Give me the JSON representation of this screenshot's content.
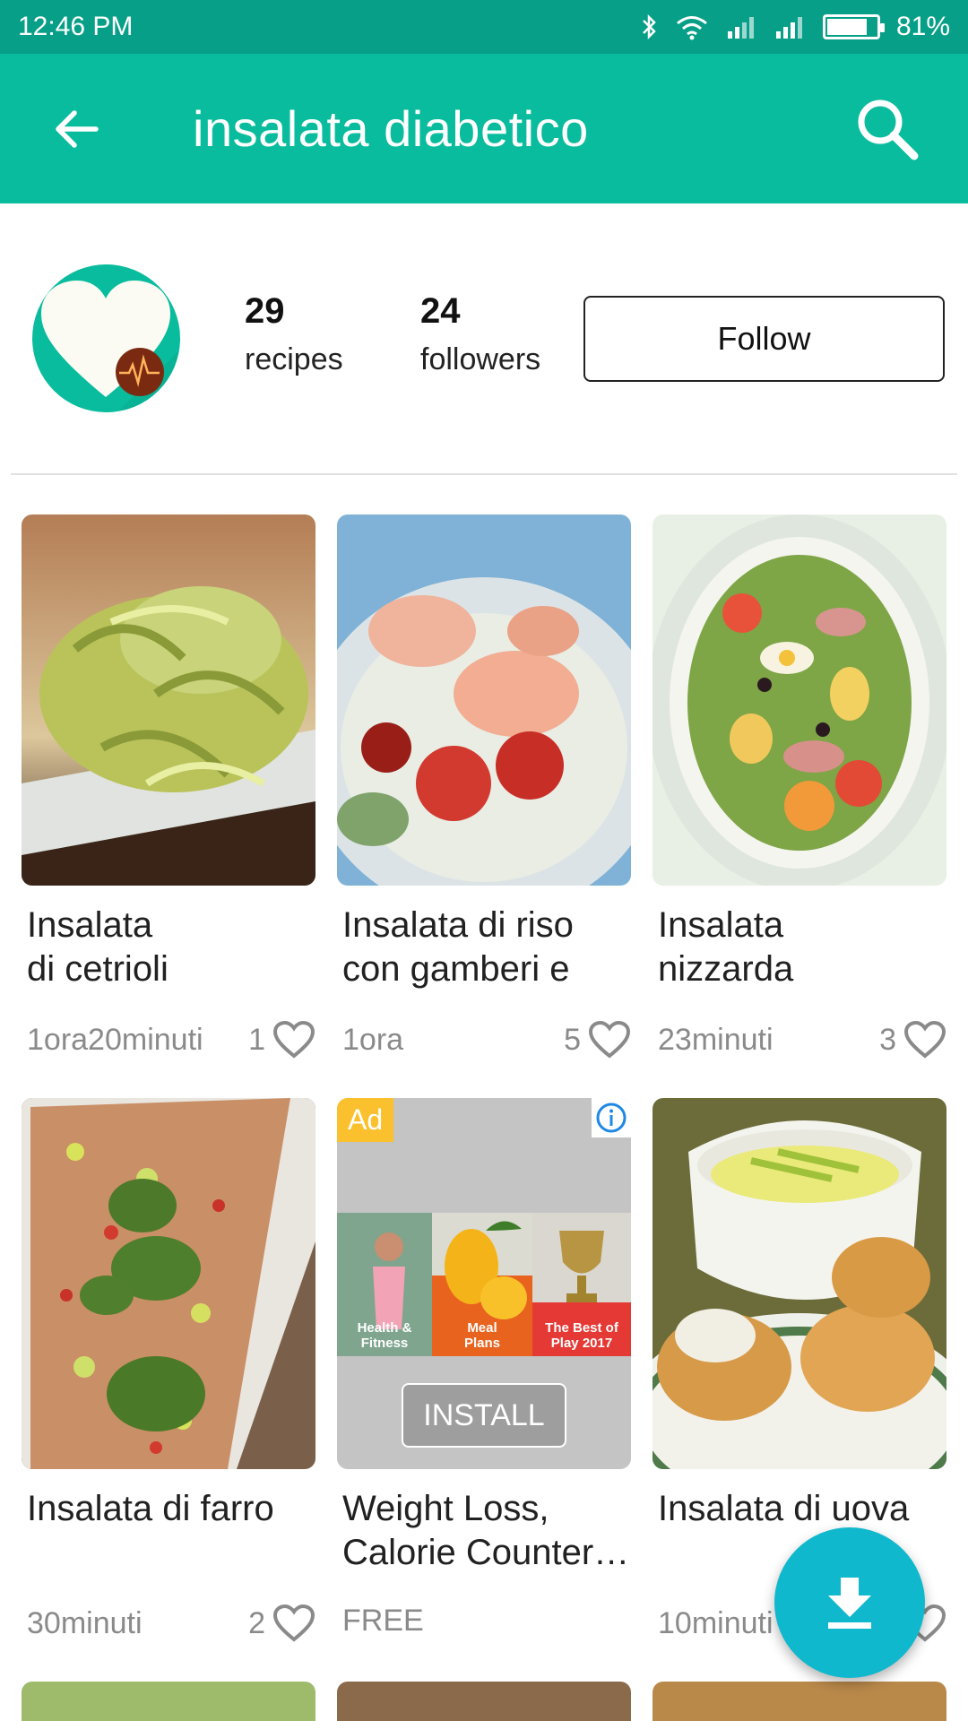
{
  "status_bar": {
    "time": "12:46 PM",
    "battery": "81%",
    "battery_level": 0.81
  },
  "app_bar": {
    "title": "insalata diabetico",
    "back_icon": "arrow-left-icon",
    "search_icon": "search-icon"
  },
  "profile": {
    "recipes_count": "29",
    "recipes_label": "recipes",
    "followers_count": "24",
    "followers_label": "followers",
    "follow_label": "Follow"
  },
  "cards": [
    {
      "title": "Insalata\ndi cetrioli",
      "time": "1ora20minuti",
      "likes": "1"
    },
    {
      "title": "Insalata di riso\ncon gamberi e",
      "time": "1ora",
      "likes": "5"
    },
    {
      "title": "Insalata\nnizzarda",
      "time": "23minuti",
      "likes": "3"
    },
    {
      "title": "Insalata di farro",
      "time": "30minuti",
      "likes": "2"
    },
    {
      "title": "Insalata di uova",
      "time": "10minuti",
      "likes": ""
    }
  ],
  "ad": {
    "badge": "Ad",
    "title": "Weight Loss,\nCalorie Counter…",
    "price": "FREE",
    "install_label": "INSTALL",
    "panels": [
      "Health &\nFitness",
      "Meal\nPlans",
      "The Best of\nPlay 2017"
    ]
  },
  "fab": {
    "icon": "download-icon"
  },
  "colors": {
    "status_bar": "#079f87",
    "app_bar": "#09bc9d",
    "fab": "#10b8cd",
    "ad_badge": "#fbc02d"
  }
}
